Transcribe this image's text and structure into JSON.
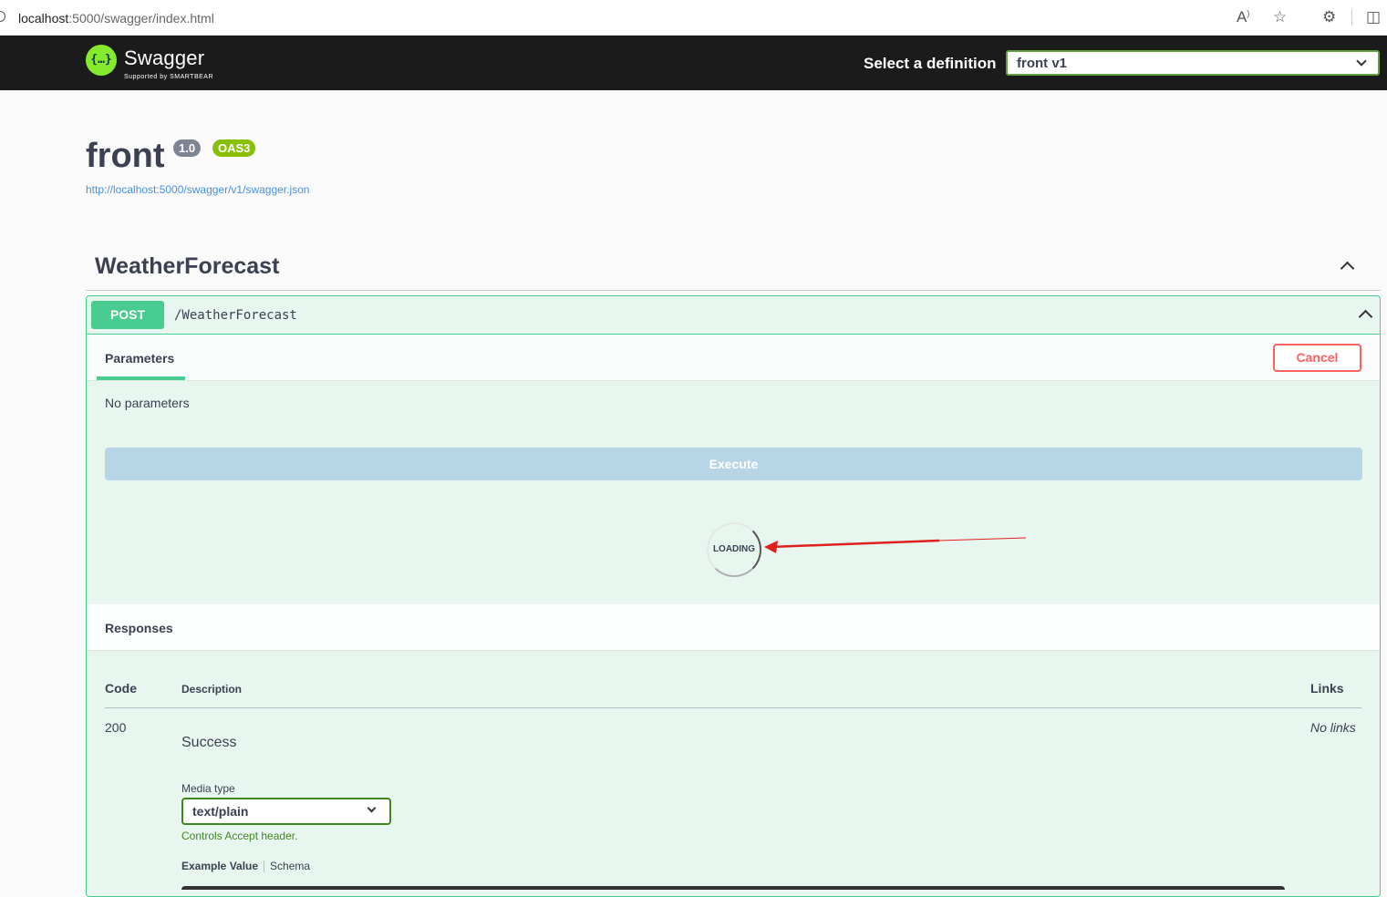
{
  "browser": {
    "url_host": "localhost",
    "url_rest": ":5000/swagger/index.html"
  },
  "topbar": {
    "logo_glyph": "{…}",
    "brand": "Swagger",
    "brand_sub": "Supported by SMARTBEAR",
    "select_label": "Select a definition",
    "selected_definition": "front v1"
  },
  "info": {
    "title": "front",
    "version": "1.0",
    "oas_badge": "OAS3",
    "spec_url": "http://localhost:5000/swagger/v1/swagger.json"
  },
  "tag": {
    "name": "WeatherForecast"
  },
  "operation": {
    "method": "POST",
    "path": "/WeatherForecast",
    "parameters_tab": "Parameters",
    "cancel_label": "Cancel",
    "no_parameters": "No parameters",
    "execute_label": "Execute",
    "loading_text": "LOADING",
    "responses_title": "Responses",
    "columns": {
      "code": "Code",
      "description": "Description",
      "links": "Links"
    },
    "responses": [
      {
        "code": "200",
        "description": "Success",
        "links": "No links",
        "media_type_label": "Media type",
        "media_type": "text/plain",
        "controls_note": "Controls Accept header.",
        "example_value_tab": "Example Value",
        "schema_tab": "Schema"
      }
    ]
  },
  "colors": {
    "post_green": "#49cc90",
    "cancel_red": "#ff6060",
    "execute_disabled": "#b8d5e8",
    "topbar_bg": "#1b1b1b",
    "annotation_arrow": "#e02020"
  }
}
